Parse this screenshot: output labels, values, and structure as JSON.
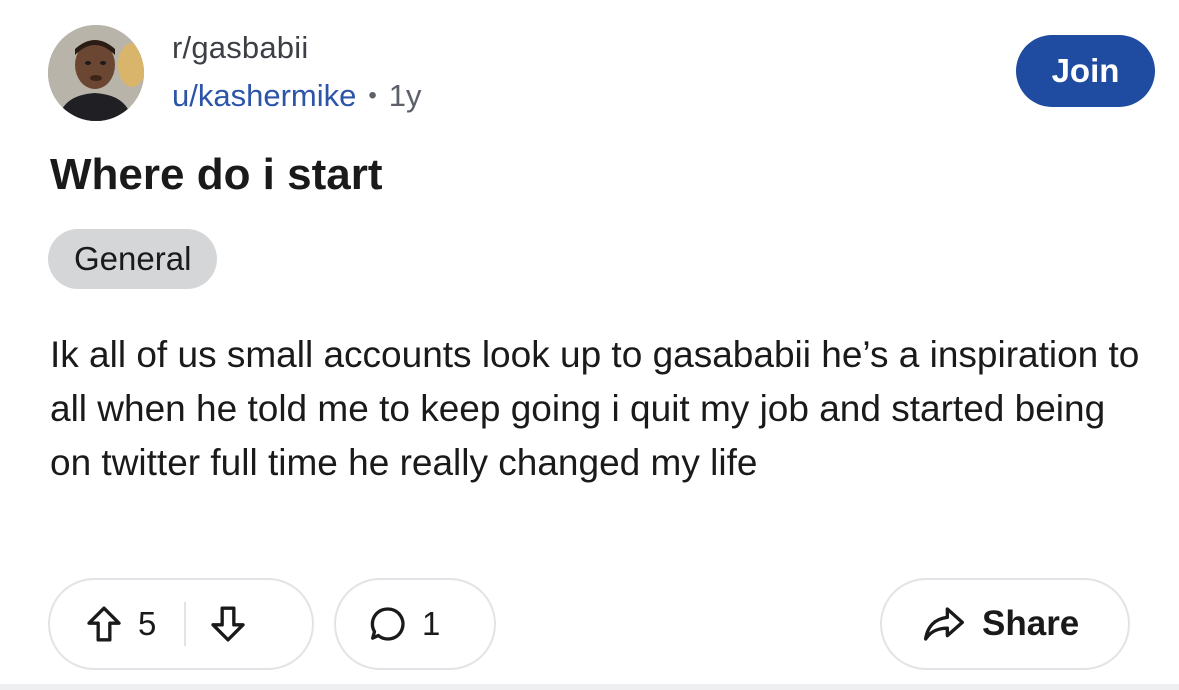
{
  "post": {
    "subreddit": "r/gasbabii",
    "author": "u/kashermike",
    "separator": "•",
    "age": "1y",
    "title": "Where do i start",
    "flair": "General",
    "body": "Ik all of us small accounts look up to gasababii he’s a inspiration to all when he told me to keep going i quit my job and started being on twitter full time he really changed my life"
  },
  "actions": {
    "join_label": "Join",
    "vote_count": "5",
    "comment_count": "1",
    "share_label": "Share"
  },
  "icons": {
    "upvote": "arrow-up-outline-icon",
    "downvote": "arrow-down-outline-icon",
    "comment": "speech-bubble-icon",
    "share": "share-arrow-icon"
  },
  "colors": {
    "join_button": "#1f4ba0",
    "author_link": "#2c55a8",
    "flair_bg": "#d5d6d8"
  }
}
